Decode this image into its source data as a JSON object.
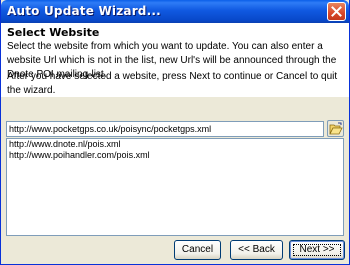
{
  "window": {
    "title": "Auto Update Wizard..."
  },
  "header": {
    "title": "Select Website",
    "description": "Select the website from which you want to update. You can also enter a website Url which is not in the list, new Url's will be announced through the Dnote POI mailing-list.",
    "instruction": "After you have selected a website, press Next to continue or Cancel to quit the wizard."
  },
  "url_field": {
    "value": "http://www.pocketgps.co.uk/poisync/pocketgps.xml"
  },
  "website_list": {
    "items": [
      "http://www.dnote.nl/pois.xml",
      "http://www.poihandler.com/pois.xml"
    ]
  },
  "buttons": {
    "cancel": "Cancel",
    "back": "<< Back",
    "next": "Next >>"
  },
  "icons": {
    "close": "close-icon",
    "browse": "folder-open-icon"
  },
  "colors": {
    "titlebar": "#0a5fe8",
    "close": "#d9472a",
    "face": "#ece9d8"
  }
}
